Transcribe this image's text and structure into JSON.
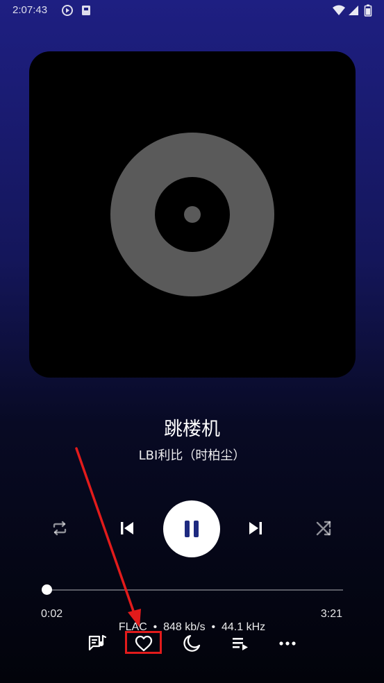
{
  "status_bar": {
    "time": "2:07:43",
    "icons": [
      "play-circle-icon",
      "storage-icon",
      "wifi-icon",
      "signal-icon",
      "battery-icon"
    ]
  },
  "album_art": {
    "icon": "vinyl-disc-icon"
  },
  "song": {
    "title": "跳楼机",
    "artist": "LBI利比（时柏尘）"
  },
  "controls": {
    "repeat_icon": "repeat-icon",
    "previous_icon": "skip-previous-icon",
    "play_pause_icon": "pause-icon",
    "next_icon": "skip-next-icon",
    "shuffle_icon": "shuffle-icon"
  },
  "progress": {
    "current": "0:02",
    "total": "3:21",
    "fraction": 0.01
  },
  "audio_info": "FLAC  •  848 kb/s  •  44.1 kHz",
  "bottom_bar": {
    "icons": [
      "lyrics-icon",
      "heart-icon",
      "sleep-timer-icon",
      "queue-icon",
      "more-icon"
    ]
  },
  "annotation": {
    "highlight_target": "heart-icon",
    "color": "#e21b1b"
  },
  "colors": {
    "bg_top": "#1e1f82",
    "bg_bottom": "#02030a",
    "play_icon": "#1e2a80",
    "disc": "#5a5a5a"
  }
}
